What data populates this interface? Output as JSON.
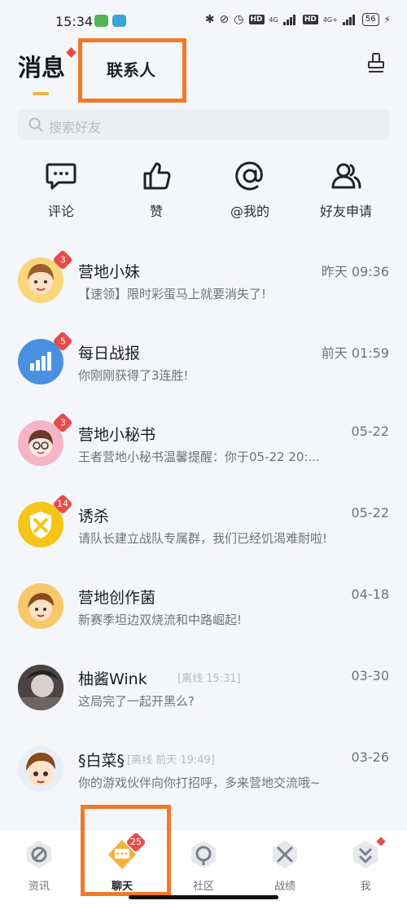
{
  "status_bar": {
    "time": "15:34",
    "network_1": "4G",
    "network_2": "4G+",
    "hd": "HD",
    "battery": "56"
  },
  "header": {
    "tab_messages": "消息",
    "tab_contacts": "联系人"
  },
  "search": {
    "placeholder": "搜索好友"
  },
  "quick_actions": [
    {
      "label": "评论",
      "icon": "comment-icon"
    },
    {
      "label": "赞",
      "icon": "thumbs-up-icon"
    },
    {
      "label": "@我的",
      "icon": "at-icon"
    },
    {
      "label": "好友申请",
      "icon": "friend-request-icon"
    }
  ],
  "conversations": [
    {
      "name": "营地小妹",
      "time": "昨天 09:36",
      "preview": "【速领】限时彩蛋马上就要消失了!",
      "badge": "3"
    },
    {
      "name": "每日战报",
      "time": "前天 01:59",
      "preview": "你刚刚获得了3连胜!",
      "badge": "5"
    },
    {
      "name": "营地小秘书",
      "time": "05-22",
      "preview": "王者营地小秘书温馨提醒：你于05-22 20:...",
      "badge": "3"
    },
    {
      "name": "诱杀",
      "time": "05-22",
      "preview": "请队长建立战队专属群，我们已经饥渴难耐啦!",
      "badge": "14"
    },
    {
      "name": "营地创作菌",
      "time": "04-18",
      "preview": "新赛季坦边双烧流和中路崛起!",
      "badge": ""
    },
    {
      "name": "柚酱Wink",
      "status": "[离线 15:31]",
      "time": "03-30",
      "preview": "这局完了一起开黑么?",
      "badge": ""
    },
    {
      "name": "§白菜§",
      "status": "[离线 前天  19:49]",
      "time": "03-26",
      "preview": "你的游戏伙伴向你打招呼，多来营地交流哦~",
      "badge": ""
    }
  ],
  "bottom_nav": [
    {
      "label": "资讯",
      "icon": "news-icon"
    },
    {
      "label": "聊天",
      "icon": "chat-icon",
      "badge": "25"
    },
    {
      "label": "社区",
      "icon": "community-icon"
    },
    {
      "label": "战绩",
      "icon": "record-icon"
    },
    {
      "label": "我",
      "icon": "profile-icon"
    }
  ],
  "colors": {
    "accent": "#f3b33c",
    "badge": "#e84b4b",
    "highlight": "#f27a26"
  }
}
